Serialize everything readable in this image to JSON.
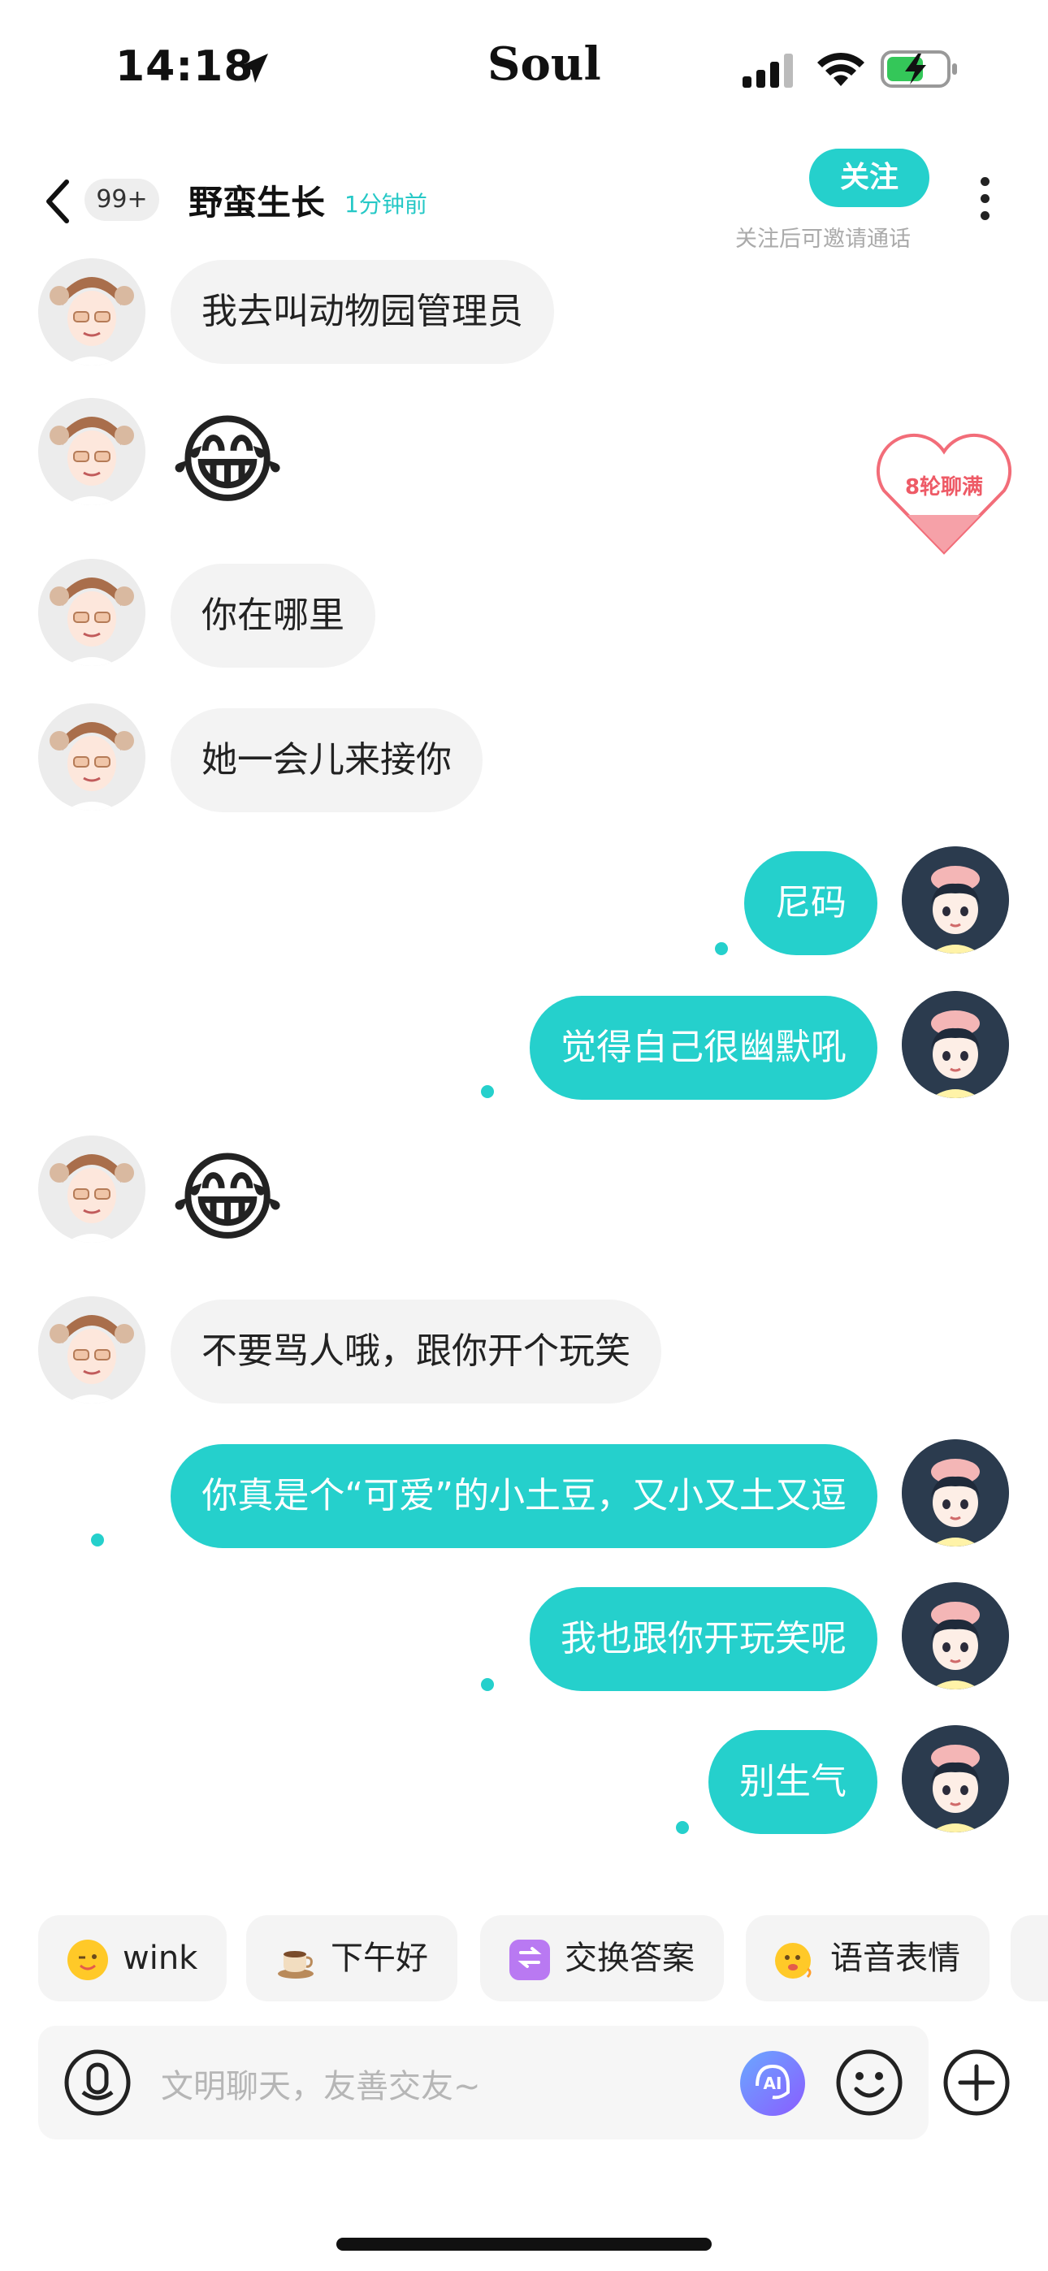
{
  "status_bar": {
    "time": "14:18",
    "center": "Soul"
  },
  "header": {
    "badge": "99+",
    "title": "野蛮生长",
    "time_ago": "1分钟前",
    "follow_label": "关注",
    "follow_hint": "关注后可邀请通话"
  },
  "heart_widget": {
    "label": "8轮聊满"
  },
  "messages": [
    {
      "side": "left",
      "text": "我去叫动物园管理员"
    },
    {
      "side": "left",
      "emoji": "😂"
    },
    {
      "side": "left",
      "text": "你在哪里"
    },
    {
      "side": "left",
      "text": "她一会儿来接你"
    },
    {
      "side": "right",
      "text": "尼码"
    },
    {
      "side": "right",
      "text": "觉得自己很幽默吼"
    },
    {
      "side": "left",
      "emoji": "😂"
    },
    {
      "side": "left",
      "text": "不要骂人哦，跟你开个玩笑"
    },
    {
      "side": "right",
      "text": "你真是个“可爱”的小土豆，又小又土又逗"
    },
    {
      "side": "right",
      "text": "我也跟你开玩笑呢"
    },
    {
      "side": "right",
      "text": "别生气"
    }
  ],
  "quick_replies": [
    {
      "icon": "wink-emoji-icon",
      "label": "wink"
    },
    {
      "icon": "coffee-icon",
      "label": "下午好"
    },
    {
      "icon": "exchange-answers-icon",
      "label": "交换答案"
    },
    {
      "icon": "voice-emoji-icon",
      "label": "语音表情"
    }
  ],
  "input": {
    "placeholder": "文明聊天，友善交友~"
  },
  "colors": {
    "accent": "#25d0cc",
    "bubble_left": "#f3f3f3",
    "text": "#222222"
  }
}
